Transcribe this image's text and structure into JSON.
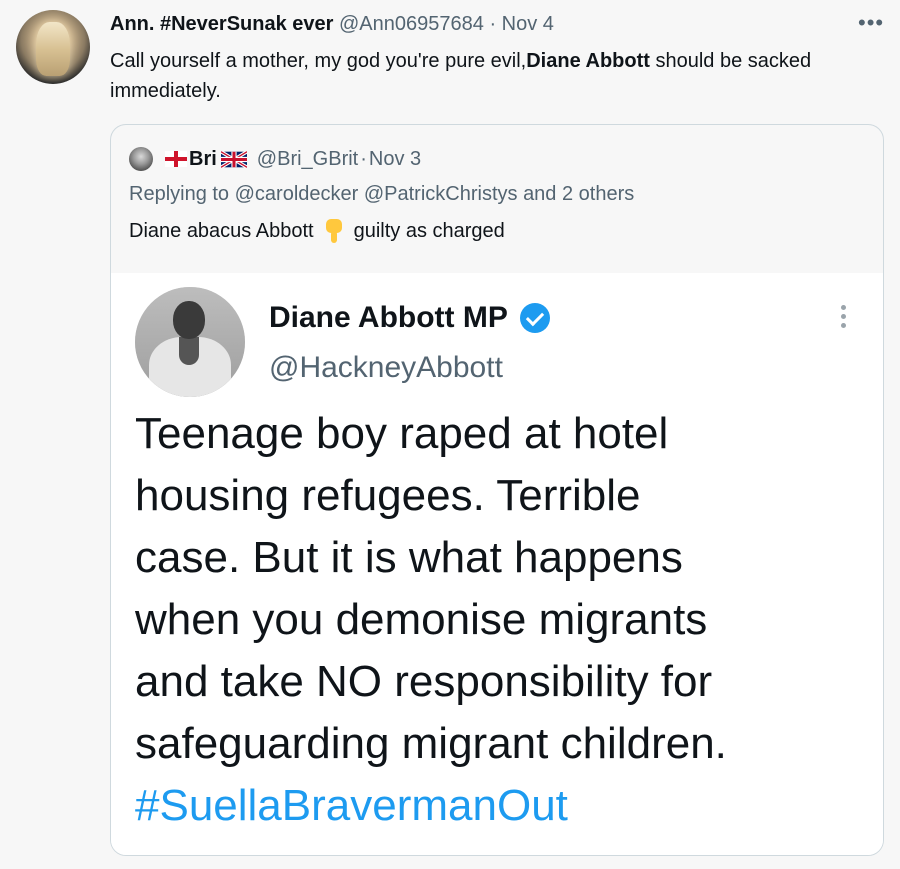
{
  "tweet": {
    "author_name": "Ann. #NeverSunak ever",
    "handle": "@Ann06957684",
    "date": "Nov 4",
    "separator": "·",
    "more_icon": "more-horizontal-icon",
    "text_before": "Call yourself a mother, my god you're pure evil,",
    "text_bold": "Diane Abbott",
    "text_after": " should be sacked immediately."
  },
  "quoted": {
    "author_name": "Bri",
    "handle": "@Bri_GBrit",
    "date": "Nov 3",
    "separator": "·",
    "flags": [
      "england-flag-icon",
      "uk-flag-icon"
    ],
    "reply_line": "Replying to @caroldecker @PatrickChristys and 2 others",
    "text_before": "Diane abacus Abbott",
    "text_after": "guilty as charged",
    "emoji": "pointing-down-hand-icon"
  },
  "embedded": {
    "name": "Diane Abbott MP",
    "handle": "@HackneyAbbott",
    "verified_color": "#1d9bf0",
    "body_lines": [
      "Teenage boy raped at hotel",
      "housing refugees. Terrible",
      "case. But it is what happens",
      "when you demonise migrants",
      "and take NO responsibility for",
      "safeguarding migrant children."
    ],
    "hashtag": "#SuellaBravermanOut"
  },
  "colors": {
    "text": "#0f1419",
    "muted": "#536471",
    "link": "#1d9bf0",
    "background": "#f7f7f7"
  }
}
